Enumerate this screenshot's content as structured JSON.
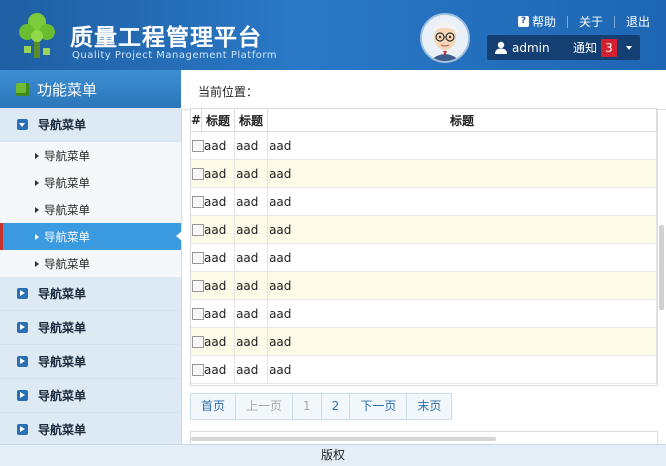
{
  "header": {
    "title_cn": "质量工程管理平台",
    "title_en": "Quality Project Management Platform",
    "links": [
      "帮助",
      "关于",
      "退出"
    ],
    "user": "admin",
    "notice_label": "通知",
    "notice_count": "3"
  },
  "sidebar": {
    "title": "功能菜单",
    "groups": [
      {
        "label": "导航菜单",
        "open": true,
        "items": [
          "导航菜单",
          "导航菜单",
          "导航菜单",
          "导航菜单",
          "导航菜单"
        ],
        "active_index": 3
      },
      {
        "label": "导航菜单"
      },
      {
        "label": "导航菜单"
      },
      {
        "label": "导航菜单"
      },
      {
        "label": "导航菜单"
      },
      {
        "label": "导航菜单"
      }
    ]
  },
  "breadcrumb": "当前位置：",
  "table": {
    "columns": [
      "#",
      "标题",
      "标题",
      "标题"
    ],
    "rows": [
      [
        "aad",
        "aad",
        "aad"
      ],
      [
        "aad",
        "aad",
        "aad"
      ],
      [
        "aad",
        "aad",
        "aad"
      ],
      [
        "aad",
        "aad",
        "aad"
      ],
      [
        "aad",
        "aad",
        "aad"
      ],
      [
        "aad",
        "aad",
        "aad"
      ],
      [
        "aad",
        "aad",
        "aad"
      ],
      [
        "aad",
        "aad",
        "aad"
      ],
      [
        "aad",
        "aad",
        "aad"
      ]
    ]
  },
  "pager": {
    "first": "首页",
    "prev": "上一页",
    "pages": [
      "1",
      "2"
    ],
    "next": "下一页",
    "last": "末页"
  },
  "footer": "版权",
  "colors": {
    "header": "#2a78c6",
    "accent": "#3b9ae0",
    "badge": "#d4202c",
    "row_alt": "#fdfae8"
  }
}
